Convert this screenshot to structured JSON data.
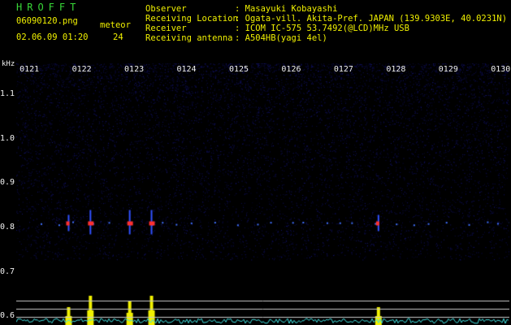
{
  "header": {
    "title": "HROFFT",
    "filename": "06090120.png",
    "datetime": "02.06.09 01:20",
    "meteor_label": "meteor",
    "meteor_count": "24"
  },
  "info": {
    "observer_label": "Observer",
    "observer_value": ": Masayuki Kobayashi",
    "location_label": "Receiving Location",
    "location_value": ": Ogata-vill. Akita-Pref. JAPAN (139.9303E, 40.0231N)",
    "receiver_label": "Receiver",
    "receiver_value": ": ICOM IC-575 53.7492(@LCD)MHz USB",
    "antenna_label": "Receiving antenna",
    "antenna_value": ": A504HB(yagi 4el)"
  },
  "axes": {
    "y_unit": "kHz",
    "y_ticks": [
      "1.1",
      "1.0",
      "0.9",
      "0.8",
      "0.7",
      "0.6"
    ],
    "x_ticks": [
      "0121",
      "0122",
      "0123",
      "0124",
      "0125",
      "0126",
      "0127",
      "0128",
      "0129",
      "0130"
    ]
  },
  "colors": {
    "background": "#000000",
    "noise": "#141478",
    "title": "#38d838",
    "label": "#f0f000",
    "text": "#f0f0f0",
    "echo": "#ff3030",
    "histogram": "#f0f000",
    "noise_floor": "#40e0e0"
  },
  "chart_data": {
    "type": "heatmap",
    "xlabel": "",
    "ylabel": "kHz",
    "xlim": [
      "01:20:45",
      "01:30:10"
    ],
    "ylim": [
      0.58,
      1.17
    ],
    "grid": false,
    "echo_band_khz": 0.81,
    "events": [
      {
        "time": "01:21:45",
        "strength": "medium"
      },
      {
        "time": "01:22:10",
        "strength": "strong"
      },
      {
        "time": "01:22:55",
        "strength": "strong"
      },
      {
        "time": "01:23:20",
        "strength": "strong"
      },
      {
        "time": "01:27:40",
        "strength": "medium"
      }
    ]
  }
}
